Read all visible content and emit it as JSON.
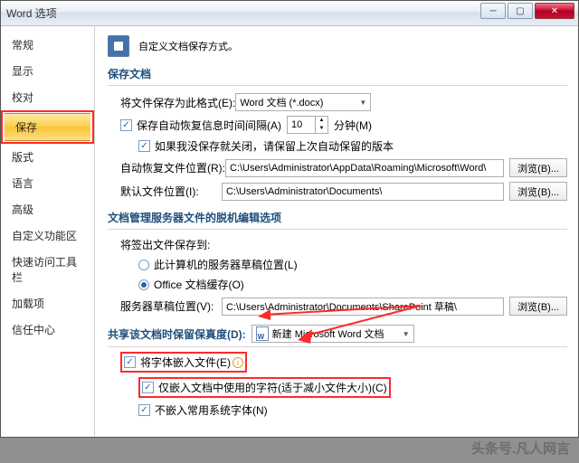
{
  "window": {
    "title": "Word 选项"
  },
  "winbtns": {
    "close": "✕"
  },
  "sidebar": {
    "items": [
      {
        "label": "常规"
      },
      {
        "label": "显示"
      },
      {
        "label": "校对"
      },
      {
        "label": "保存",
        "active": true
      },
      {
        "label": "版式"
      },
      {
        "label": "语言"
      },
      {
        "label": "高级"
      },
      {
        "label": "自定义功能区"
      },
      {
        "label": "快速访问工具栏"
      },
      {
        "label": "加载项"
      },
      {
        "label": "信任中心"
      }
    ]
  },
  "header": "自定义文档保存方式。",
  "section1": {
    "title": "保存文档",
    "format_label": "将文件保存为此格式(E):",
    "format_value": "Word 文档 (*.docx)",
    "autorecover_cb": "保存自动恢复信息时间间隔(A)",
    "autorecover_value": "10",
    "autorecover_unit": "分钟(M)",
    "keeplast_cb": "如果我没保存就关闭，请保留上次自动保留的版本",
    "autorecover_loc_label": "自动恢复文件位置(R):",
    "autorecover_loc_value": "C:\\Users\\Administrator\\AppData\\Roaming\\Microsoft\\Word\\",
    "default_loc_label": "默认文件位置(I):",
    "default_loc_value": "C:\\Users\\Administrator\\Documents\\",
    "browse": "浏览(B)..."
  },
  "section2": {
    "title": "文档管理服务器文件的脱机编辑选项",
    "checkout_label": "将签出文件保存到:",
    "radio1": "此计算机的服务器草稿位置(L)",
    "radio2": "Office 文档缓存(O)",
    "drafts_label": "服务器草稿位置(V):",
    "drafts_value": "C:\\Users\\Administrator\\Documents\\SharePoint 草稿\\",
    "browse": "浏览(B)..."
  },
  "section3": {
    "fidelity_label": "共享该文档时保留保真度(D):",
    "doc_name": "新建 Microsoft Word 文档",
    "embed_fonts": "将字体嵌入文件(E)",
    "embed_used": "仅嵌入文档中使用的字符(适于减小文件大小)(C)",
    "no_system": "不嵌入常用系统字体(N)"
  },
  "watermark": "头条号.凡人网言"
}
